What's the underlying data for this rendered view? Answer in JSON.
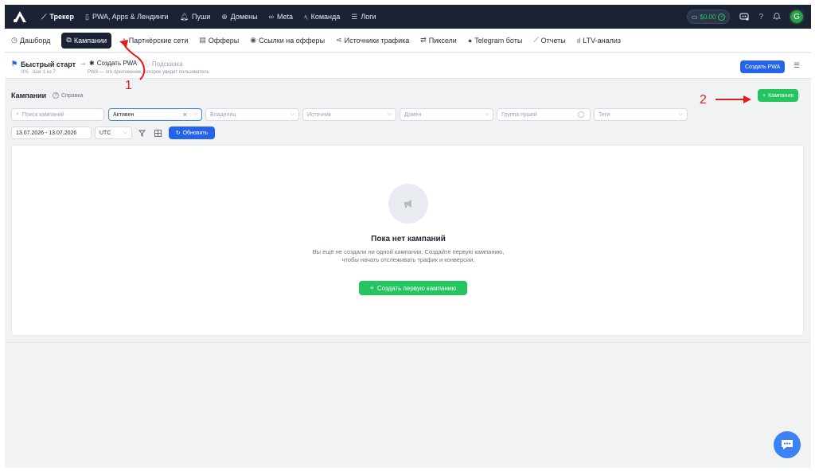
{
  "topnav": {
    "items": [
      {
        "label": "Трекер",
        "icon": "chart-line-icon",
        "glyph": "⟋"
      },
      {
        "label": "PWA, Apps & Лендинги",
        "icon": "phone-icon",
        "glyph": "▯"
      },
      {
        "label": "Пуши",
        "icon": "bell-icon",
        "glyph": "🔔︎"
      },
      {
        "label": "Домены",
        "icon": "globe-icon",
        "glyph": "⊕"
      },
      {
        "label": "Meta",
        "icon": "meta-icon",
        "glyph": "∞"
      },
      {
        "label": "Команда",
        "icon": "team-icon",
        "glyph": "ﾍ"
      },
      {
        "label": "Логи",
        "icon": "list-icon",
        "glyph": "☰"
      }
    ],
    "balance": "$0.00",
    "avatar": "G"
  },
  "subnav": {
    "items": [
      {
        "label": "Дашборд",
        "icon": "dashboard-icon",
        "glyph": "◷"
      },
      {
        "label": "Кампании",
        "icon": "edit-icon",
        "glyph": "⧉"
      },
      {
        "label": "Партнёрские сети",
        "icon": "partners-icon",
        "glyph": "ﾍ"
      },
      {
        "label": "Офферы",
        "icon": "offers-icon",
        "glyph": "▤"
      },
      {
        "label": "Ссылки на офферы",
        "icon": "location-icon",
        "glyph": "◉"
      },
      {
        "label": "Источники трафика",
        "icon": "share-icon",
        "glyph": "⋖"
      },
      {
        "label": "Пиксели",
        "icon": "arrows-icon",
        "glyph": "⇄"
      },
      {
        "label": "Telegram боты",
        "icon": "telegram-icon",
        "glyph": "●"
      },
      {
        "label": "Отчеты",
        "icon": "report-icon",
        "glyph": "⟋"
      },
      {
        "label": "LTV-анализ",
        "icon": "bar-chart-icon",
        "glyph": "ıl"
      }
    ]
  },
  "quickstart": {
    "title": "Быстрый старт",
    "progress": "0% · Шаг 1 из 7",
    "step": "Создать PWA",
    "hint": "Подсказка",
    "description": "PWA — это приложение, которое увидит пользователь",
    "create_pwa": "Создать PWA"
  },
  "campaigns": {
    "title": "Кампании",
    "help": "Справка",
    "add_button": "Кампания"
  },
  "filters": {
    "search_placeholder": "Поиск кампаний",
    "status": "Активен",
    "owner": "Владелец",
    "source": "Источник",
    "domain": "Домен",
    "push_group": "Группа пушей",
    "tags": "Теги",
    "date_range": "13.07.2026 - 13.07.2026",
    "timezone": "UTC",
    "refresh": "Обновить"
  },
  "empty_state": {
    "title": "Пока нет кампаний",
    "text": "Вы ещё не создали ни одной кампании. Создайте первую кампанию, чтобы начать отслеживать трафик и конверсии.",
    "button": "Создать первую кампанию"
  },
  "annotations": {
    "first": "1",
    "second": "2",
    "color": "#e11d1d"
  },
  "colors": {
    "nav_bg": "#1b2233",
    "primary": "#2563eb",
    "success": "#22c55e"
  }
}
